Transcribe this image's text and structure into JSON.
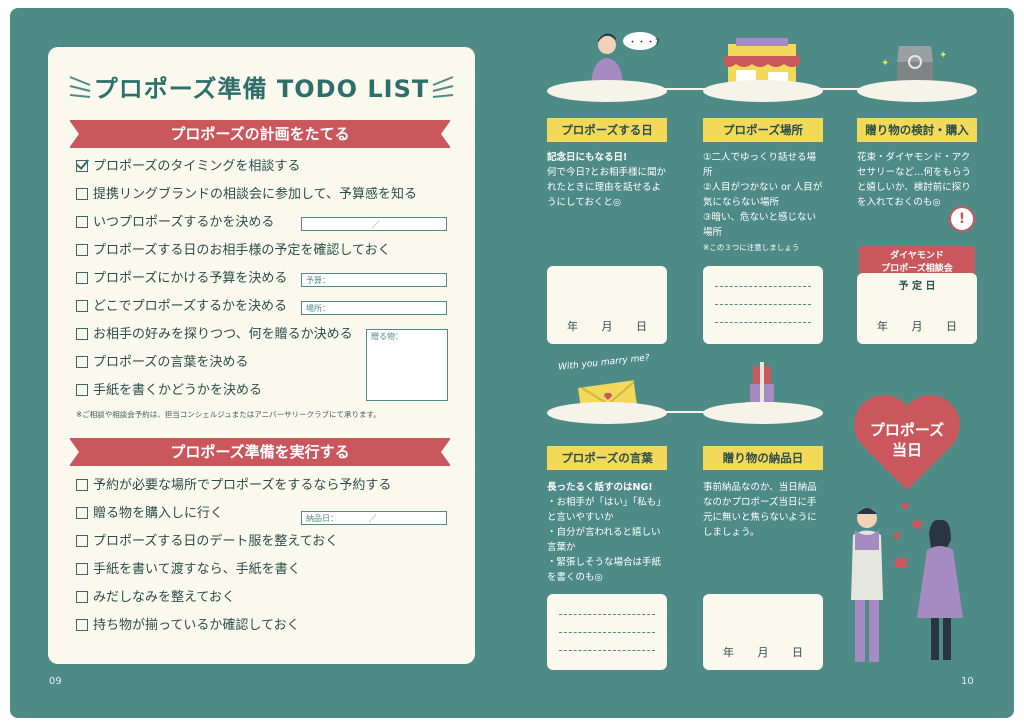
{
  "left_page": {
    "title": "プロポーズ準備 TODO LIST",
    "section1_title": "プロポーズの計画をたてる",
    "section1_items": [
      {
        "label": "プロポーズのタイミングを相談する",
        "checked": true
      },
      {
        "label": "提携リングブランドの相談会に参加して、予算感を知る",
        "checked": false
      },
      {
        "label": "いつプロポーズするかを決める",
        "checked": false
      },
      {
        "label": "プロポーズする日のお相手様の予定を確認しておく",
        "checked": false
      },
      {
        "label": "プロポーズにかける予算を決める",
        "checked": false
      },
      {
        "label": "どこでプロポーズするかを決める",
        "checked": false
      },
      {
        "label": "お相手の好みを探りつつ、何を贈るか決める",
        "checked": false
      },
      {
        "label": "プロポーズの言葉を決める",
        "checked": false
      },
      {
        "label": "手紙を書くかどうかを決める",
        "checked": false
      }
    ],
    "date_field_sep": "／",
    "budget_field_label": "予算：",
    "place_field_label": "場所：",
    "gift_field_label": "贈る物：",
    "note": "※ご相談や相談会予約は、担当コンシェルジュまたはアニバーサリークラブにて承ります。",
    "section2_title": "プロポーズ準備を実行する",
    "section2_items": [
      {
        "label": "予約が必要な場所でプロポーズをするなら予約する",
        "checked": false
      },
      {
        "label": "贈る物を購入しに行く",
        "checked": false
      },
      {
        "label": "プロポーズする日のデート服を整えておく",
        "checked": false
      },
      {
        "label": "手紙を書いて渡すなら、手紙を書く",
        "checked": false
      },
      {
        "label": "みだしなみを整えておく",
        "checked": false
      },
      {
        "label": "持ち物が揃っているか確認しておく",
        "checked": false
      }
    ],
    "delivery_field_label": "納品日：",
    "delivery_field_sep": "／",
    "page_number": "09"
  },
  "right_page": {
    "speech_bubble": "・・・?",
    "step1": {
      "label": "プロポーズする日",
      "bold": "記念日にもなる日!",
      "text": "何で今日?とお相手様に聞かれたときに理由を話せるようにしておくと◎"
    },
    "step2": {
      "label": "プロポーズ場所",
      "items": [
        "①二人でゆっくり話せる場所",
        "②人目がつかない or 人目が気にならない場所",
        "③暗い、危ないと感じない場所"
      ],
      "note": "※この３つに注意しましょう"
    },
    "step3": {
      "label": "贈り物の検討・購入",
      "text": "花束・ダイヤモンド・アクセサリーなど…何をもらうと嬉しいか、検討前に探りを入れておくのも◎"
    },
    "alert": "!",
    "consult_badge": [
      "ダイヤモンド",
      "プロポーズ相談会"
    ],
    "schedule_label": "予 定 日",
    "ymd": [
      "年",
      "月",
      "日"
    ],
    "envelope_caption": "With you marry me?",
    "step4": {
      "label": "プロポーズの言葉",
      "bold": "長ったるく話すのはNG!",
      "items": [
        "・お相手が「はい」「私も」と言いやすいか",
        "・自分が言われると嬉しい言葉か",
        "・緊張しそうな場合は手紙を書くのも◎"
      ]
    },
    "step5": {
      "label": "贈り物の納品日",
      "text": "事前納品なのか、当日納品なのかプロポーズ当日に手元に無いと焦らないようにしましょう。"
    },
    "heart_text": [
      "プロポーズ",
      "当日"
    ],
    "page_number": "10"
  },
  "colors": {
    "teal": "#4f8b86",
    "red": "#c9575c",
    "yellow": "#f2d95a",
    "cream": "#fbf9ee"
  }
}
